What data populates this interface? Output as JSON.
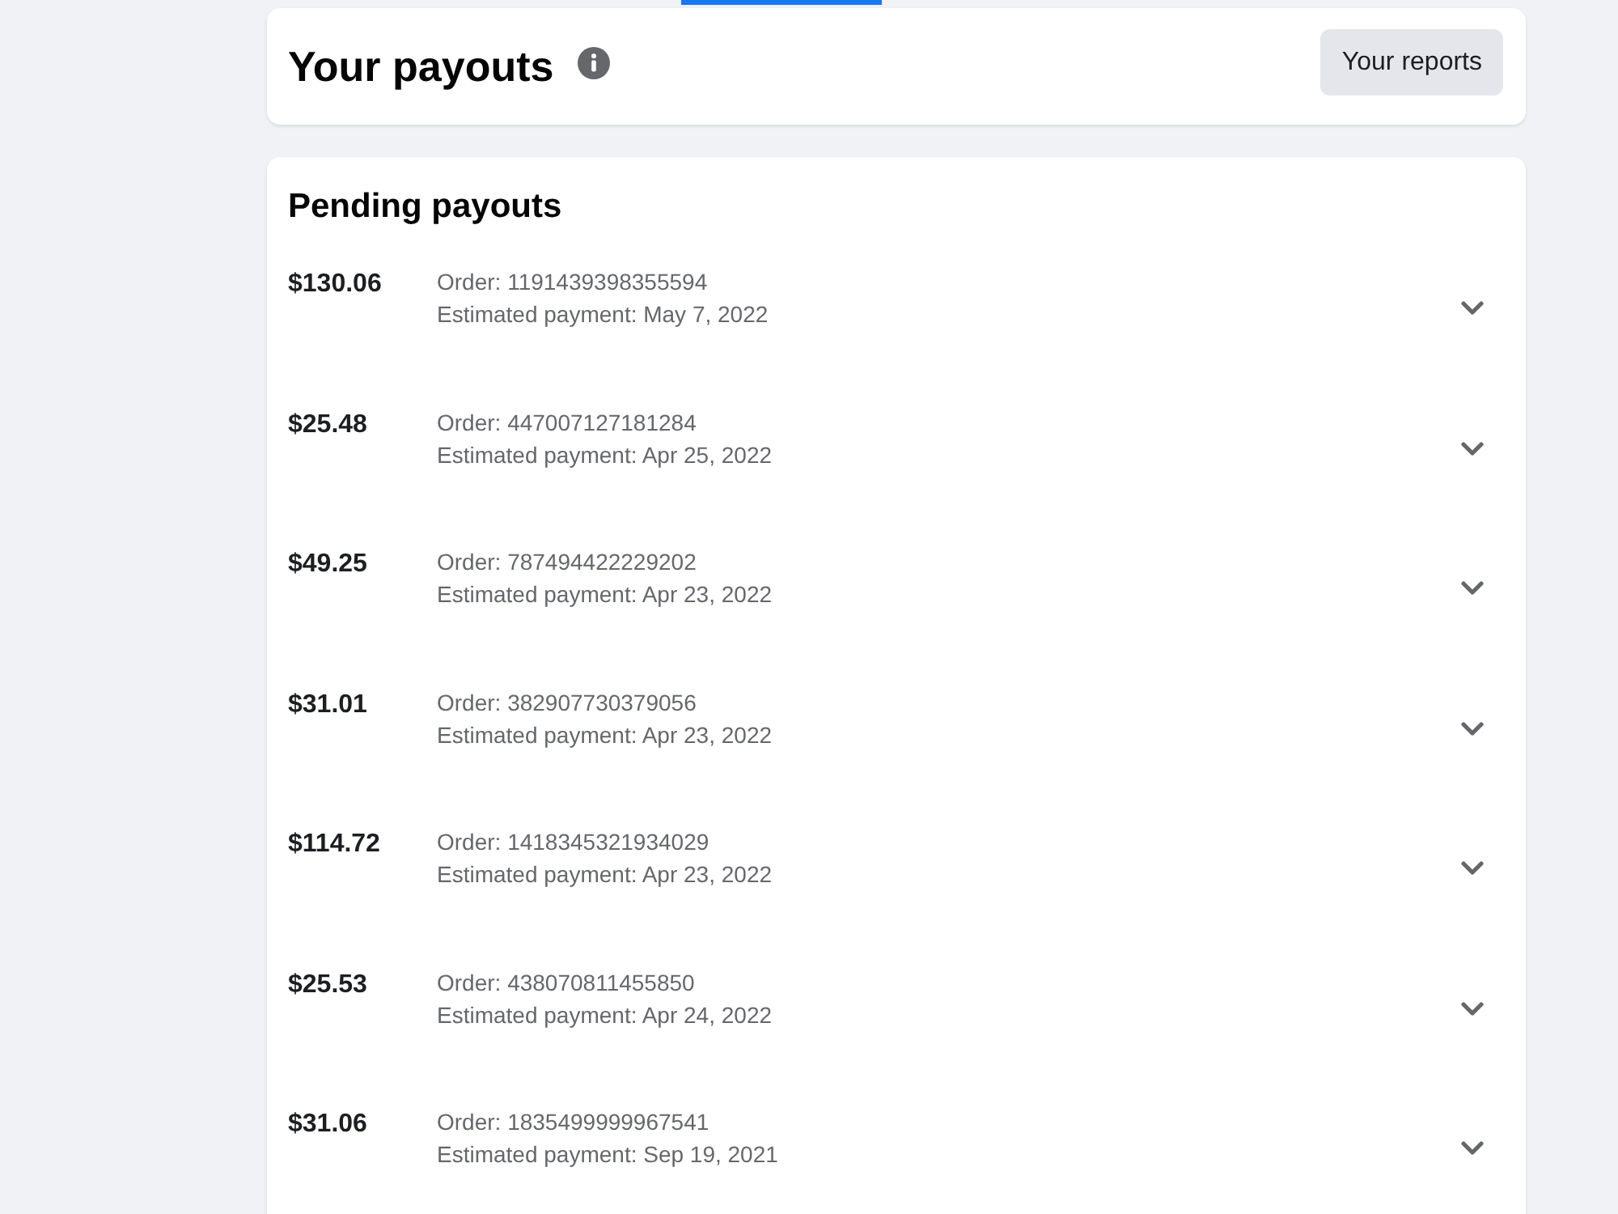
{
  "header": {
    "title": "Your payouts",
    "reports_button": "Your reports"
  },
  "pending": {
    "title": "Pending payouts",
    "payouts": [
      {
        "amount": "$130.06",
        "order": "Order: 1191439398355594",
        "estimated": "Estimated payment: May 7, 2022",
        "expanded": false
      },
      {
        "amount": "$25.48",
        "order": "Order: 447007127181284",
        "estimated": "Estimated payment: Apr 25, 2022",
        "expanded": false
      },
      {
        "amount": "$49.25",
        "order": "Order: 787494422229202",
        "estimated": "Estimated payment: Apr 23, 2022",
        "expanded": false
      },
      {
        "amount": "$31.01",
        "order": "Order: 382907730379056",
        "estimated": "Estimated payment: Apr 23, 2022",
        "expanded": false
      },
      {
        "amount": "$114.72",
        "order": "Order: 1418345321934029",
        "estimated": "Estimated payment: Apr 23, 2022",
        "expanded": false
      },
      {
        "amount": "$25.53",
        "order": "Order: 438070811455850",
        "estimated": "Estimated payment: Apr 24, 2022",
        "expanded": false
      },
      {
        "amount": "$31.06",
        "order": "Order: 1835499999967541",
        "estimated": "Estimated payment: Sep 19, 2021",
        "expanded": false
      }
    ]
  }
}
